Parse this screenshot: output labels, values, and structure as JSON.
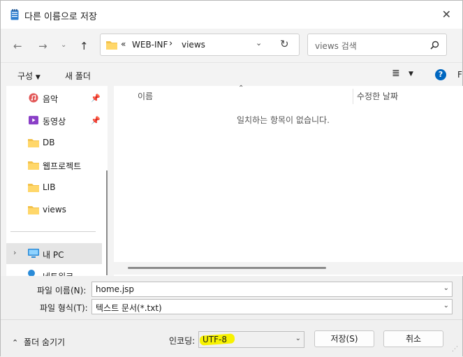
{
  "window": {
    "title": "다른 이름으로 저장"
  },
  "address": {
    "overflow": "«",
    "crumbs": [
      "WEB-INF",
      "views"
    ],
    "separator": "›"
  },
  "search": {
    "placeholder": "views 검색"
  },
  "toolbar": {
    "organize": "구성",
    "new_folder": "새 폴더",
    "help_cut": "F"
  },
  "nav_pane": {
    "items": [
      {
        "label": "음악",
        "icon": "music-icon",
        "pinned": true
      },
      {
        "label": "동영상",
        "icon": "video-icon",
        "pinned": true
      },
      {
        "label": "DB",
        "icon": "folder-icon",
        "pinned": false
      },
      {
        "label": "웹프로젝트",
        "icon": "folder-icon",
        "pinned": false
      },
      {
        "label": "LIB",
        "icon": "folder-icon",
        "pinned": false
      },
      {
        "label": "views",
        "icon": "folder-icon",
        "pinned": false
      }
    ],
    "this_pc": "내 PC",
    "network_partial": "네트워크"
  },
  "content": {
    "columns": [
      "이름",
      "수정한 날짜"
    ],
    "empty_message": "일치하는 항목이 없습니다."
  },
  "form": {
    "filename_label": "파일 이름(N):",
    "filename_value": "home.jsp",
    "filetype_label": "파일 형식(T):",
    "filetype_value": "텍스트 문서(*.txt)",
    "encoding_label": "인코딩:",
    "encoding_value": "UTF-8",
    "hide_folders": "폴더 숨기기",
    "save": "저장(S)",
    "cancel": "취소"
  },
  "colors": {
    "accent": "#0067c0",
    "highlight": "#f7f200",
    "folder": "#f3c24b"
  }
}
